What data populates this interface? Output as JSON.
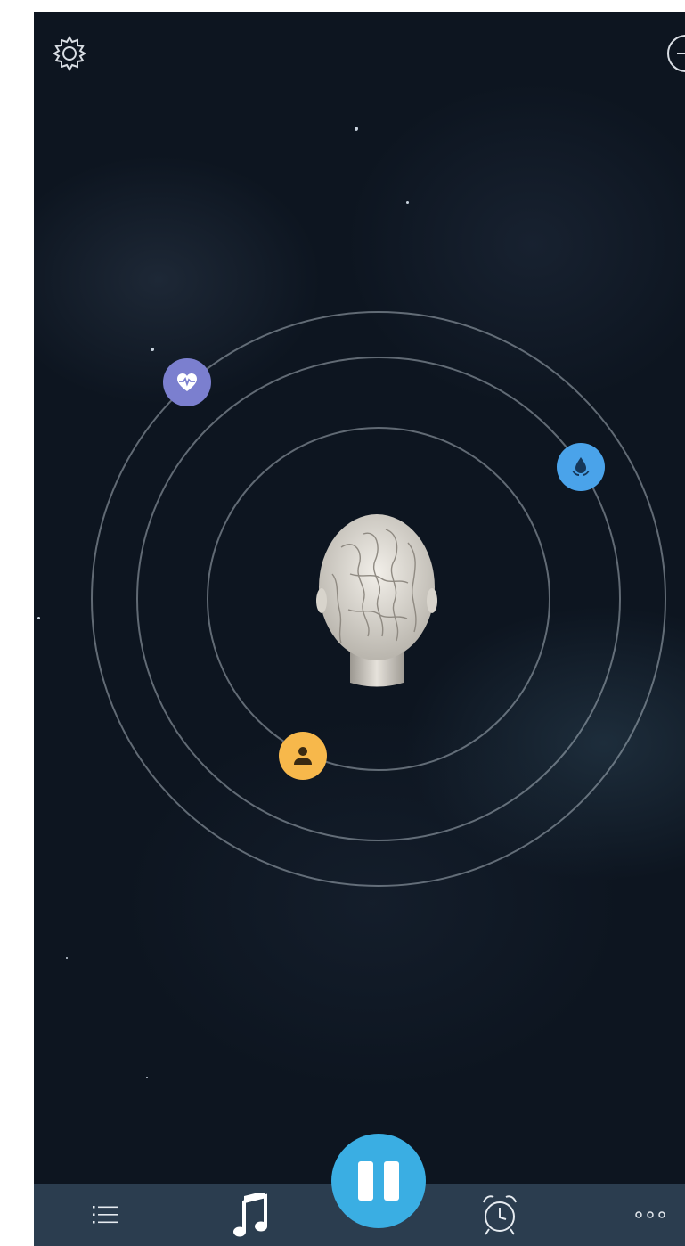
{
  "top_bar": {
    "settings_icon": "gear-icon",
    "minus_icon": "minus-circle-icon"
  },
  "orbit_icons": [
    {
      "name": "heart-rate-icon",
      "color": "#7b7fcf"
    },
    {
      "name": "water-drop-icon",
      "color": "#4aa3ea"
    },
    {
      "name": "person-icon",
      "color": "#f7b84b"
    }
  ],
  "center_figure": "braided-head-icon",
  "tab_bar": {
    "background": "#2b3d4f",
    "tabs": [
      {
        "icon": "list-icon"
      },
      {
        "icon": "music-note-icon"
      },
      {
        "icon": "alarm-clock-icon"
      },
      {
        "icon": "more-dots-icon"
      }
    ],
    "play_button": {
      "icon": "pause-icon",
      "color": "#3aaee3"
    }
  }
}
